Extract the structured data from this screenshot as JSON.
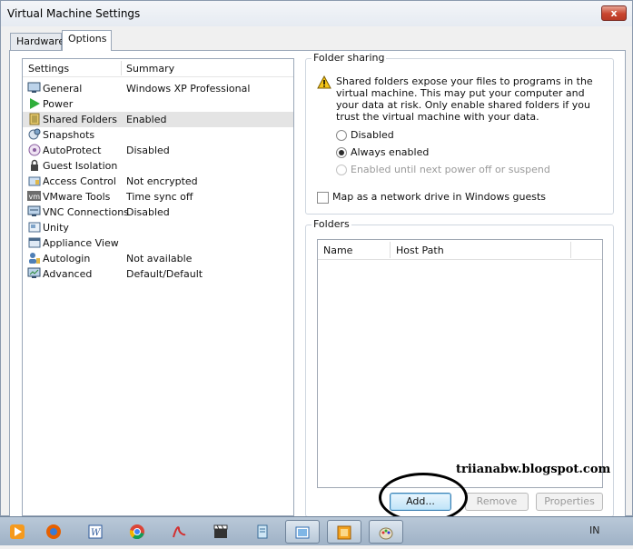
{
  "window": {
    "title": "Virtual Machine Settings",
    "close_glyph": "x"
  },
  "tabs": [
    {
      "label": "Hardware"
    },
    {
      "label": "Options"
    }
  ],
  "settings_list": {
    "col_settings": "Settings",
    "col_summary": "Summary",
    "items": [
      {
        "name": "General",
        "summary": "Windows XP Professional",
        "icon": "monitor-icon"
      },
      {
        "name": "Power",
        "summary": "",
        "icon": "play-icon"
      },
      {
        "name": "Shared Folders",
        "summary": "Enabled",
        "icon": "folder-icon"
      },
      {
        "name": "Snapshots",
        "summary": "",
        "icon": "snapshot-icon"
      },
      {
        "name": "AutoProtect",
        "summary": "Disabled",
        "icon": "autoprotect-icon"
      },
      {
        "name": "Guest Isolation",
        "summary": "",
        "icon": "lock-icon"
      },
      {
        "name": "Access Control",
        "summary": "Not encrypted",
        "icon": "access-icon"
      },
      {
        "name": "VMware Tools",
        "summary": "Time sync off",
        "icon": "vm-icon"
      },
      {
        "name": "VNC Connections",
        "summary": "Disabled",
        "icon": "vnc-icon"
      },
      {
        "name": "Unity",
        "summary": "",
        "icon": "unity-icon"
      },
      {
        "name": "Appliance View",
        "summary": "",
        "icon": "appliance-icon"
      },
      {
        "name": "Autologin",
        "summary": "Not available",
        "icon": "user-icon"
      },
      {
        "name": "Advanced",
        "summary": "Default/Default",
        "icon": "advanced-icon"
      }
    ]
  },
  "folder_sharing": {
    "title": "Folder sharing",
    "warning": "Shared folders expose your files to programs in the virtual machine. This may put your computer and your data at risk. Only enable shared folders if you trust the virtual machine with your data.",
    "option_disabled": "Disabled",
    "option_always": "Always enabled",
    "option_until": "Enabled until next power off or suspend",
    "map_drive": "Map as a network drive in Windows guests"
  },
  "folders": {
    "title": "Folders",
    "col_name": "Name",
    "col_host_path": "Host Path",
    "add": "Add...",
    "remove": "Remove",
    "properties": "Properties"
  },
  "watermark": "triianabw.blogspot.com",
  "taskbar": {
    "language": "IN",
    "items": [
      "media-player-icon",
      "firefox-icon",
      "word-icon",
      "chrome-icon",
      "acrobat-icon",
      "clapper-icon",
      "notepad-icon",
      "screenshot-icon",
      "vmware-icon",
      "paint-icon"
    ]
  }
}
